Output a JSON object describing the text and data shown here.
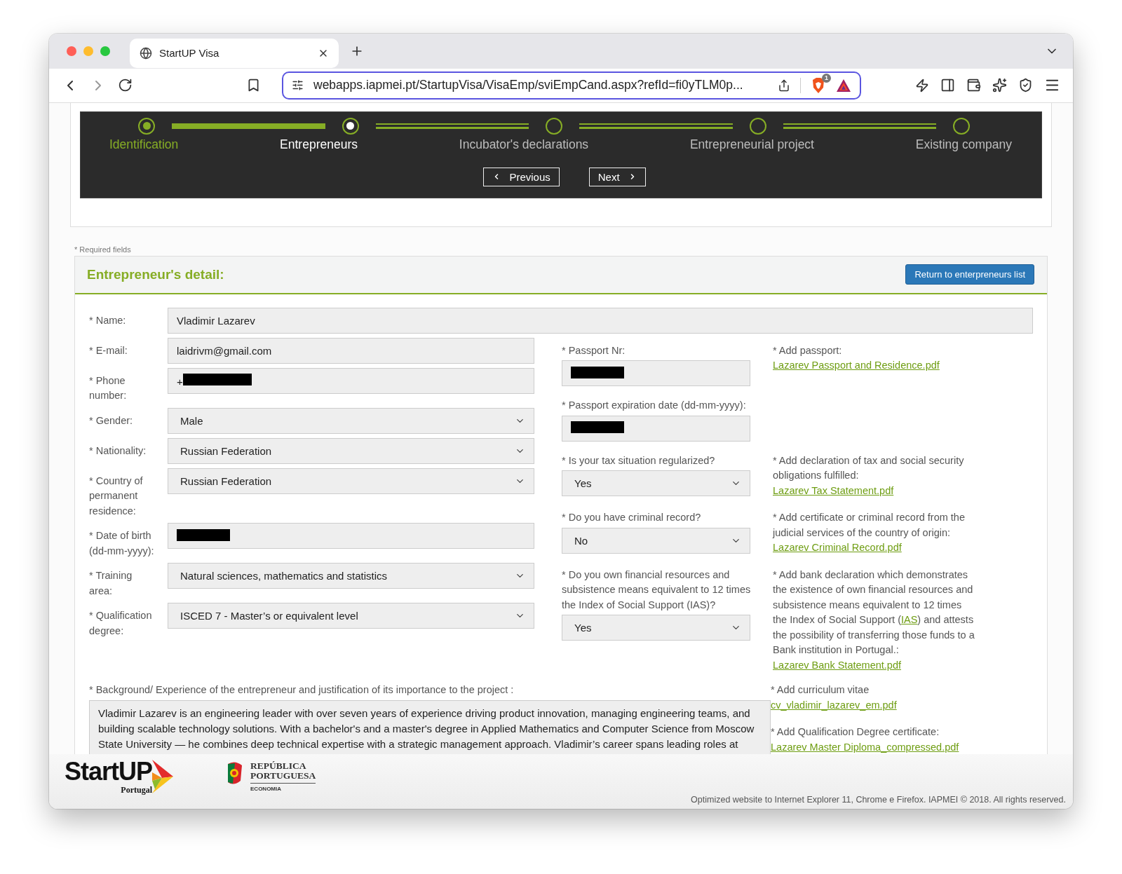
{
  "browser": {
    "tab_title": "StartUP Visa",
    "url": "webapps.iapmei.pt/StartupVisa/VisaEmp/sviEmpCand.aspx?refId=fi0yTLM0p...",
    "shield_badge": "1"
  },
  "stepper": {
    "steps": [
      {
        "label": "Identification",
        "done": true,
        "selected": false
      },
      {
        "label": "Entrepreneurs",
        "done": false,
        "selected": true
      },
      {
        "label": "Incubator's declarations",
        "done": false,
        "selected": false
      },
      {
        "label": "Entrepreneurial project",
        "done": false,
        "selected": false
      },
      {
        "label": "Existing company",
        "done": false,
        "selected": false
      }
    ],
    "previous": "Previous",
    "next": "Next"
  },
  "required_note": "* Required fields",
  "detail": {
    "title": "Entrepreneur's detail:",
    "return_button": "Return to enterpreneurs list",
    "name": {
      "label": "* Name:",
      "value": "Vladimir Lazarev"
    },
    "personal_fields": [
      {
        "label": "* E-mail:",
        "kind": "text",
        "value": "laidrivm@gmail.com"
      },
      {
        "label": "* Phone number:",
        "kind": "text",
        "value": "+",
        "redacted": true
      },
      {
        "label": "* Gender:",
        "kind": "select",
        "value": "Male"
      },
      {
        "label": "* Nationality:",
        "kind": "select",
        "value": "Russian Federation"
      },
      {
        "label": "* Country of permanent residence:",
        "kind": "select",
        "value": "Russian Federation"
      },
      {
        "label": "* Date of birth (dd-mm-yyyy):",
        "kind": "text",
        "redacted": true
      },
      {
        "label": "* Training area:",
        "kind": "select",
        "value": "Natural sciences, mathematics and statistics"
      },
      {
        "label": "* Qualification degree:",
        "kind": "select",
        "value": "ISCED 7 - Master’s or equivalent level"
      }
    ],
    "document_rows": [
      {
        "question": {
          "label": "* Passport Nr:",
          "kind": "text",
          "redacted": true
        },
        "attachment": {
          "label_parts": [
            {
              "text": "* Add passport:",
              "link": false
            }
          ],
          "file": "Lazarev Passport and Residence.pdf"
        }
      },
      {
        "question": {
          "label": "* Passport expiration date (dd-mm-yyyy):",
          "kind": "text",
          "redacted": true
        }
      },
      {
        "question": {
          "label": "* Is your tax situation regularized?",
          "kind": "select",
          "value": "Yes"
        },
        "attachment": {
          "label_parts": [
            {
              "text": "* Add declaration of tax and social security obligations fulfilled:",
              "link": false
            }
          ],
          "file": "Lazarev Tax Statement.pdf"
        }
      },
      {
        "question": {
          "label": "* Do you have criminal record?",
          "kind": "select",
          "value": "No"
        },
        "attachment": {
          "label_parts": [
            {
              "text": "* Add certificate or criminal record from the judicial services of the country of origin:",
              "link": false
            }
          ],
          "file": "Lazarev Criminal Record.pdf"
        }
      },
      {
        "question": {
          "label": "* Do you own financial resources and subsistence means equivalent to 12 times the Index of Social Support (IAS)?",
          "kind": "select",
          "value": "Yes"
        },
        "attachment": {
          "label_parts": [
            {
              "text": "* Add bank declaration which demonstrates the existence of own financial resources and subsistence means equivalent to 12 times the Index of Social Support (",
              "link": false
            },
            {
              "text": "IAS",
              "link": true
            },
            {
              "text": ") and attests the possibility of transferring those funds to a Bank institution in Portugal.:",
              "link": false
            }
          ],
          "file": "Lazarev Bank Statement.pdf"
        }
      }
    ],
    "background": {
      "label": "* Background/ Experience of the entrepreneur and justification of its importance to the project :",
      "value": "Vladimir Lazarev is an engineering leader with over seven years of experience driving product innovation, managing engineering teams, and building scalable technology solutions. With a bachelor's and a master's degree in Applied Mathematics and Computer Science from Moscow State University — he combines deep technical expertise with a strategic management approach. Vladimir’s career spans leading roles at"
    },
    "extra_attachments": [
      {
        "label_parts": [
          {
            "text": "* Add curriculum vitae",
            "link": false
          }
        ],
        "file": "cv_vladimir_lazarev_em.pdf"
      },
      {
        "label_parts": [
          {
            "text": "* Add Qualification Degree certificate:",
            "link": false
          }
        ],
        "file": "Lazarev Master Diploma_compressed.pdf"
      }
    ]
  },
  "footer": {
    "startup_logo": {
      "word": "StartUP",
      "sub": "Portugal"
    },
    "republic_logo": {
      "line1": "REPÚBLICA",
      "line2": "PORTUGUESA",
      "sub": "ECONOMIA"
    },
    "note": "Optimized website to Internet Explorer 11, Chrome e Firefox. IAPMEI © 2018. All rights reserved."
  }
}
